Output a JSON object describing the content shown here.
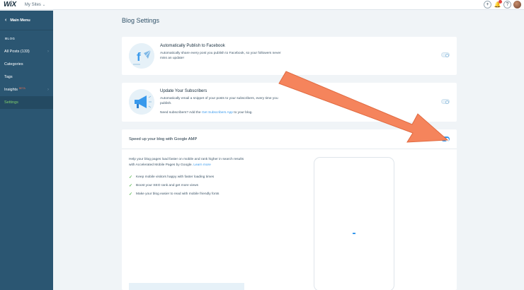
{
  "topbar": {
    "logo": "WiX",
    "sites_label": "My Sites",
    "add_icon": "plus-icon",
    "notifications_icon": "bell-icon",
    "help_label": "?",
    "avatar_icon": "avatar"
  },
  "sidebar": {
    "main_menu_label": "Main Menu",
    "section_title": "BLOG",
    "items": [
      {
        "label": "All Posts (133)",
        "has_arrow": true
      },
      {
        "label": "Categories",
        "has_arrow": false
      },
      {
        "label": "Tags",
        "has_arrow": false
      },
      {
        "label": "Insights",
        "badge": "BETA",
        "has_arrow": true
      },
      {
        "label": "Settings",
        "active": true
      }
    ]
  },
  "page": {
    "title": "Blog Settings"
  },
  "facebook": {
    "title": "Automatically Publish to Facebook",
    "description": "Automatically share every post you publish to Facebook, so your followers never miss an update!",
    "enabled": false
  },
  "subscribers": {
    "title": "Update Your Subscribers",
    "description": "Automatically email a snippet of your posts to your subscribers, every time you publish.",
    "need_prefix": "Need subscribers? Add the ",
    "need_link": "Get Subscribers App",
    "need_suffix": " to your blog.",
    "enabled": false
  },
  "amp": {
    "title": "Speed up your blog with Google AMP",
    "description": "Help your blog pages load faster on mobile and rank higher in search results with Accelerated Mobile Pages by Google.",
    "learn_more": "Learn more",
    "benefits": [
      "Keep mobile visitors happy with faster loading times",
      "Boost your SEO rank and get more views",
      "Make your blog easier to read with mobile friendly fonts"
    ],
    "enabled": true
  },
  "colors": {
    "sidebar_bg": "#2b5672",
    "accent": "#3899ec",
    "active_nav": "#7fcf6d",
    "annotation_arrow": "#f5845c"
  }
}
